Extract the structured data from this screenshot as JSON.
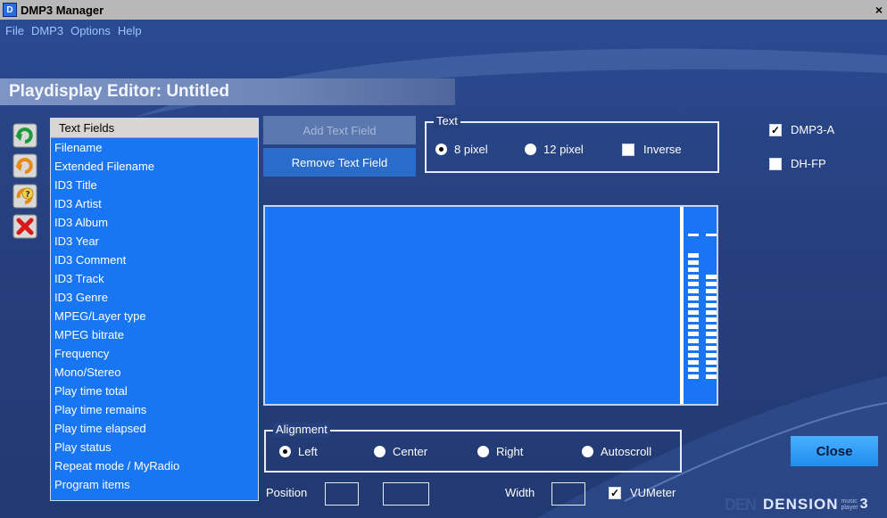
{
  "window": {
    "app_icon_glyph": "D",
    "title": "DMP3 Manager",
    "close_glyph": "×"
  },
  "menu": [
    "File",
    "DMP3",
    "Options",
    "Help"
  ],
  "editor_title": "Playdisplay Editor: Untitled",
  "side_icons": [
    "add-green-arrow-icon",
    "orange-arrow-icon",
    "help-question-icon",
    "delete-x-icon"
  ],
  "list": {
    "header": "Text Fields",
    "items": [
      "Filename",
      "Extended Filename",
      "ID3 Title",
      "ID3 Artist",
      "ID3 Album",
      "ID3 Year",
      "ID3 Comment",
      "ID3 Track",
      "ID3 Genre",
      "MPEG/Layer type",
      "MPEG bitrate",
      "Frequency",
      "Mono/Stereo",
      "Play time total",
      "Play time remains",
      "Play time elapsed",
      "Play status",
      "Repeat mode / MyRadio",
      "Program items"
    ]
  },
  "buttons": {
    "add_text_field": "Add Text Field",
    "remove_text_field": "Remove Text Field",
    "close": "Close"
  },
  "text_group": {
    "legend": "Text",
    "opt_8": "8 pixel",
    "opt_12": "12 pixel",
    "selected": "8 pixel",
    "inverse": "Inverse",
    "inverse_checked": false
  },
  "devices": {
    "dmp3a": "DMP3-A",
    "dmp3a_checked": true,
    "dhfp": "DH-FP",
    "dhfp_checked": false
  },
  "alignment": {
    "legend": "Alignment",
    "left": "Left",
    "center": "Center",
    "right": "Right",
    "autoscroll": "Autoscroll",
    "selected": "Left"
  },
  "bottom": {
    "position_label": "Position",
    "position_x": "",
    "position_y": "",
    "width_label": "Width",
    "width_value": "",
    "vumeter": "VUMeter",
    "vumeter_checked": true
  },
  "brand": {
    "ghost": "DEN",
    "name": "DENSION",
    "music": "music",
    "player": "player",
    "version": "3"
  },
  "colors": {
    "background": "#27407e",
    "list": "#1976f2",
    "preview": "#1975f3",
    "close_button": "#1e8ef0"
  }
}
